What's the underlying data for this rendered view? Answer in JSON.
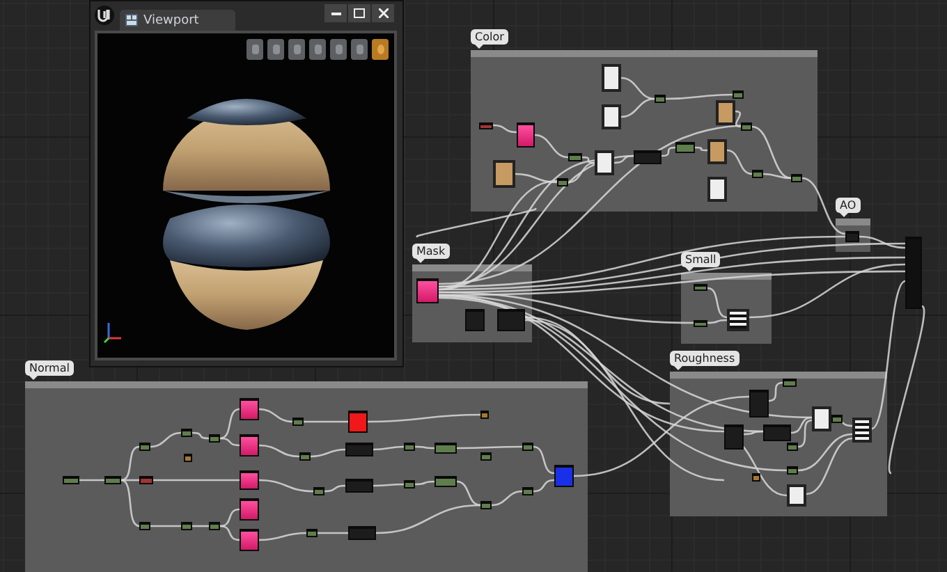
{
  "viewport": {
    "title": "Viewport",
    "tools": [
      {
        "selected": false
      },
      {
        "selected": false
      },
      {
        "selected": false
      },
      {
        "selected": false
      },
      {
        "selected": false
      },
      {
        "selected": false
      },
      {
        "selected": true
      }
    ]
  },
  "comments": [
    {
      "label": "Color"
    },
    {
      "label": "AO"
    },
    {
      "label": "Mask"
    },
    {
      "label": "Small"
    },
    {
      "label": "Normal"
    },
    {
      "label": "Roughness"
    }
  ]
}
